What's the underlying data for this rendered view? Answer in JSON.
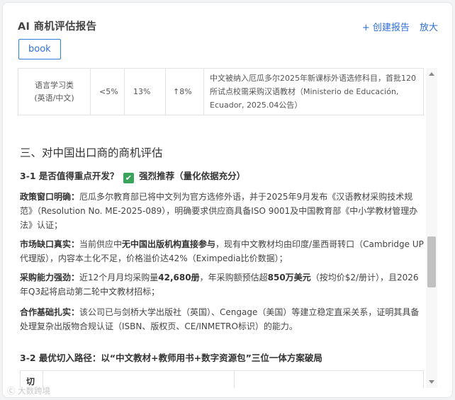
{
  "header": {
    "title": "AI 商机评估报告",
    "create_label": "+ 创建报告",
    "zoom_label": "放大"
  },
  "tag": {
    "label": "book"
  },
  "table_row": {
    "category": "语言学习类",
    "category_sub": "(英语/中文)",
    "share": "<5%",
    "rate": "13%",
    "trend": "↑8%",
    "note": "中文被纳入厄瓜多尔2025年新课标外语选修科目，首批120所试点校需采购汉语教材（Ministerio de Educación, Ecuador, 2025.04公告）"
  },
  "section": {
    "title": "三、对中国出口商的商机评估",
    "sub31_title": "3-1 是否值得重点开发？",
    "sub31_verdict": "强烈推荐（量化依据充分）",
    "policy_label": "政策窗口明确：",
    "policy_text": "厄瓜多尔教育部已将中文列为官方选修外语，并于2025年9月发布《汉语教材采购技术规范》（Resolution No. ME-2025-089），明确要求供应商具备ISO 9001及中国教育部《中小学教材管理办法》认证；",
    "market_label": "市场缺口真实：",
    "market_text_a": "当前供应中",
    "market_bold": "无中国出版机构直接参与",
    "market_text_b": "，现有中文教材均由印度/墨西哥转口（Cambridge UP代理版），内容本土化不足，价格溢价达42%（Eximpedia比价数据）；",
    "purchase_label": "采购能力强劲：",
    "purchase_text_a": "近12个月月均采购量",
    "purchase_bold_a": "42,680册",
    "purchase_text_b": "，年采购额预估超",
    "purchase_bold_b": "850万美元",
    "purchase_text_c": "（按均价$2/册计），且2026年Q3起将启动第二轮中文教材招标；",
    "coop_label": "合作基础扎实：",
    "coop_text": "该公司已与剑桥大学出版社（英国）、Cengage（美国）等建立稳定直采关系，证明其具备处理复杂出版物合规认证（ISBN、版权页、CE/INMETRO标识）的能力。",
    "sub32_title": "3-2 最优切入路径：以“中文教材+教师用书+数字资源包”三位一体方案破局",
    "table2_first_cell": "切"
  },
  "watermark": {
    "text": "Ⓒ 大数跨境"
  }
}
